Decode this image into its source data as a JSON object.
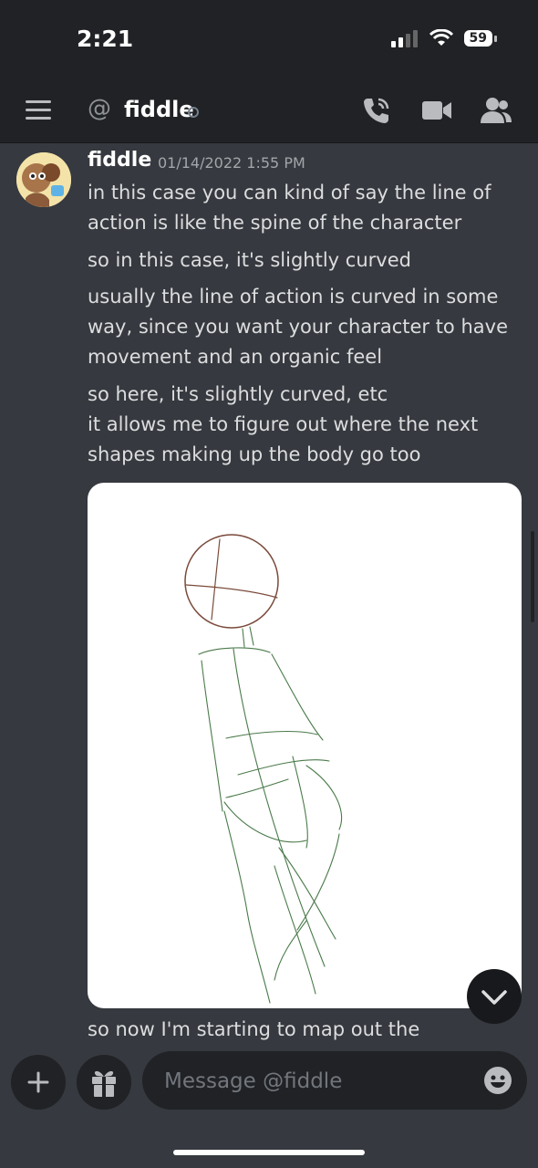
{
  "status_bar": {
    "time": "2:21",
    "battery": "59"
  },
  "header": {
    "channel_name": "fiddle",
    "at_symbol": "@",
    "icons": [
      "hamburger-icon",
      "phone-call-icon",
      "video-camera-icon",
      "members-icon"
    ]
  },
  "message": {
    "author": "fiddle",
    "timestamp": "01/14/2022 1:55 PM",
    "lines": [
      "in this case you can kind of say the line of",
      "action is like the spine of the character",
      "so in this case, it's slightly curved",
      "usually the line of action is curved in some",
      "way, since you want your character to have",
      "movement and an organic feel",
      "so here, it's slightly curved, etc",
      "it allows me to figure out where the next",
      "shapes making up the body go too"
    ],
    "after_image_line": "so now I'm starting to map out the"
  },
  "composer": {
    "placeholder": "Message @fiddle"
  },
  "colors": {
    "background": "#36393f",
    "header": "#202225",
    "text": "#dcddde",
    "muted": "#a3a6aa",
    "sketch_head": "#7a4a3a",
    "sketch_body": "#4a7a4a"
  }
}
